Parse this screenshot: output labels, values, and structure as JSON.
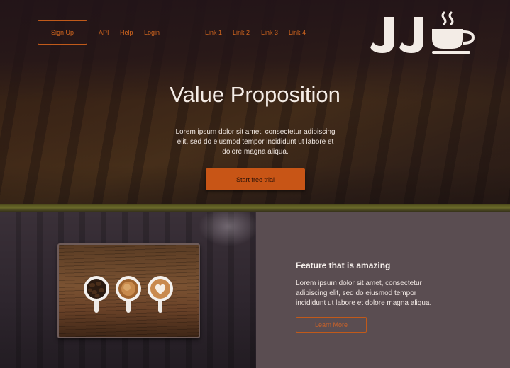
{
  "nav": {
    "signup_label": "Sign Up",
    "links_left": [
      "API",
      "Help",
      "Login"
    ],
    "links_right": [
      "Link 1",
      "Link 2",
      "Link 3",
      "Link 4"
    ]
  },
  "logo": {
    "letters": "JJ",
    "icon": "coffee-cup-icon"
  },
  "hero": {
    "title": "Value Proposition",
    "text": "Lorem ipsum dolor sit amet, consectetur adipiscing elit, sed do eiusmod tempor incididunt ut labore et dolore magna aliqua.",
    "cta_label": "Start free trial"
  },
  "feature": {
    "title": "Feature that is amazing",
    "text": "Lorem ipsum dolor sit amet, consectetur adipiscing elit, sed do eiusmod tempor incididunt ut labore et dolore magna aliqua.",
    "button_label": "Learn More"
  },
  "colors": {
    "accent": "#c85516",
    "dark_bg": "#1e1416",
    "panel_bg": "#5a4d51",
    "text_light": "#f4ece6"
  }
}
